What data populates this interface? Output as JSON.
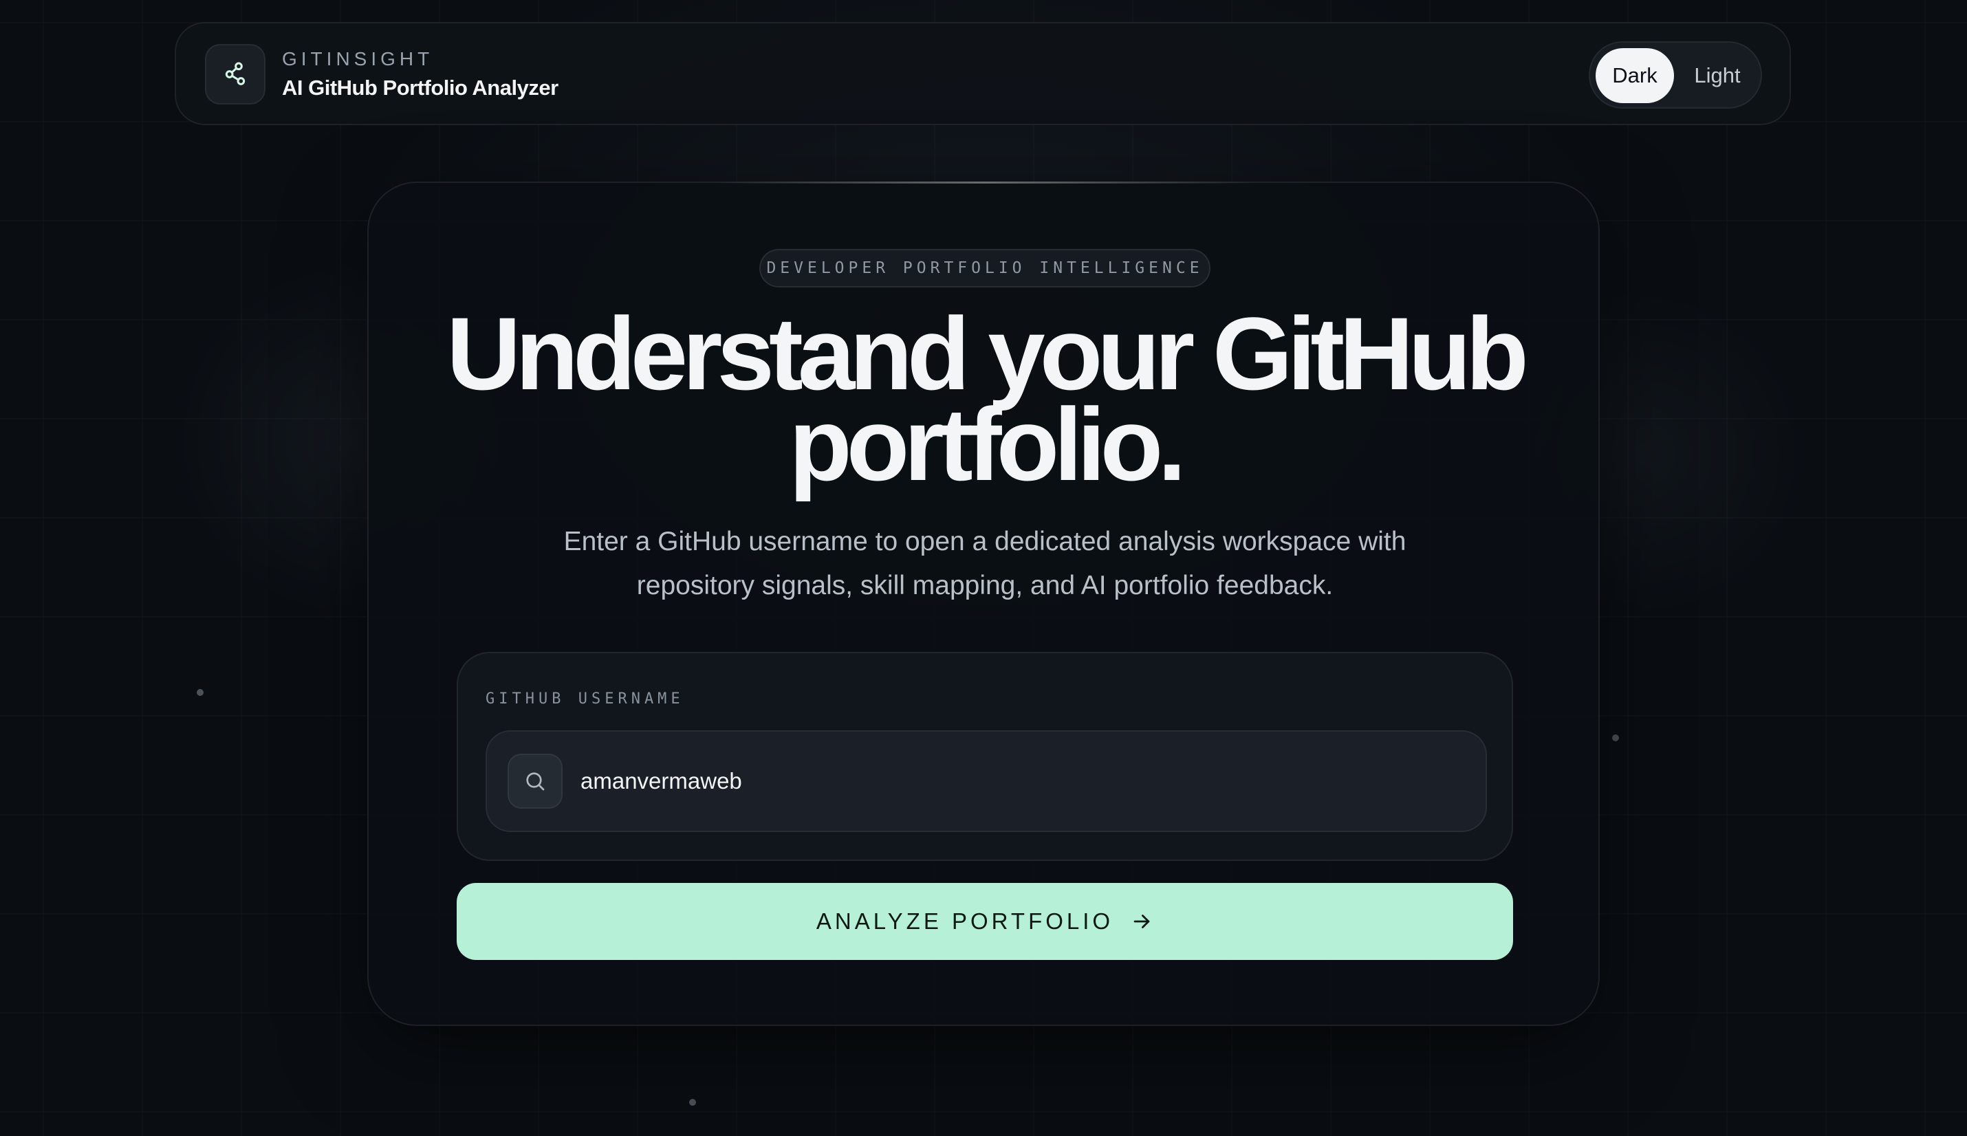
{
  "header": {
    "brand_name": "GITINSIGHT",
    "brand_subtitle": "AI GitHub Portfolio Analyzer",
    "logo_icon": "share-nodes-icon",
    "theme_options": [
      "Dark",
      "Light"
    ],
    "theme_selected": "Dark"
  },
  "hero": {
    "eyebrow": "DEVELOPER PORTFOLIO INTELLIGENCE",
    "headline_line1": "Understand your GitHub",
    "headline_line2": "portfolio.",
    "description": "Enter a GitHub username to open a dedicated analysis workspace with repository signals, skill mapping, and AI portfolio feedback."
  },
  "form": {
    "label": "GITHUB USERNAME",
    "username_value": "amanvermaweb",
    "search_icon": "search-icon",
    "submit_label": "ANALYZE PORTFOLIO",
    "submit_icon": "arrow-right-icon"
  },
  "colors": {
    "background": "#0a0e13",
    "accent": "#b6f0d6",
    "text_primary": "#f4f5f7",
    "text_muted": "#b9c0c8"
  }
}
